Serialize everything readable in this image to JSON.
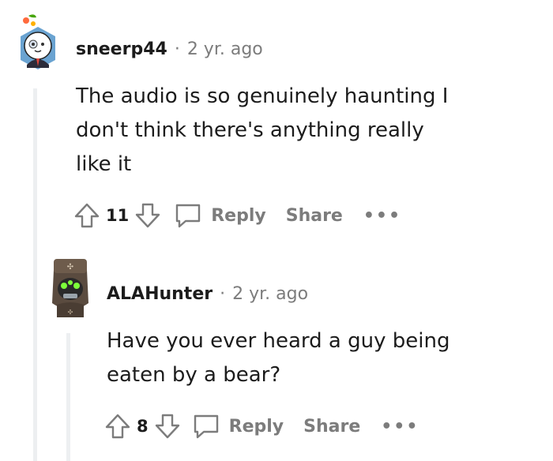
{
  "comments": [
    {
      "author": "sneerp44",
      "separator": "·",
      "time": "2 yr. ago",
      "body_lines": [
        "The audio is so genuinely haunting I",
        "don't think there's anything really",
        "like it"
      ],
      "score": "11",
      "reply_label": "Reply",
      "share_label": "Share",
      "more_label": "•••"
    },
    {
      "author": "ALAHunter",
      "separator": "·",
      "time": "2 yr. ago",
      "body_lines": [
        "Have you ever heard a guy being",
        "eaten by a bear?"
      ],
      "score": "8",
      "reply_label": "Reply",
      "share_label": "Share",
      "more_label": "•••"
    }
  ],
  "colors": {
    "meta_gray": "#7c7c7c",
    "thread_line": "#edeff1",
    "text": "#1c1c1c"
  }
}
